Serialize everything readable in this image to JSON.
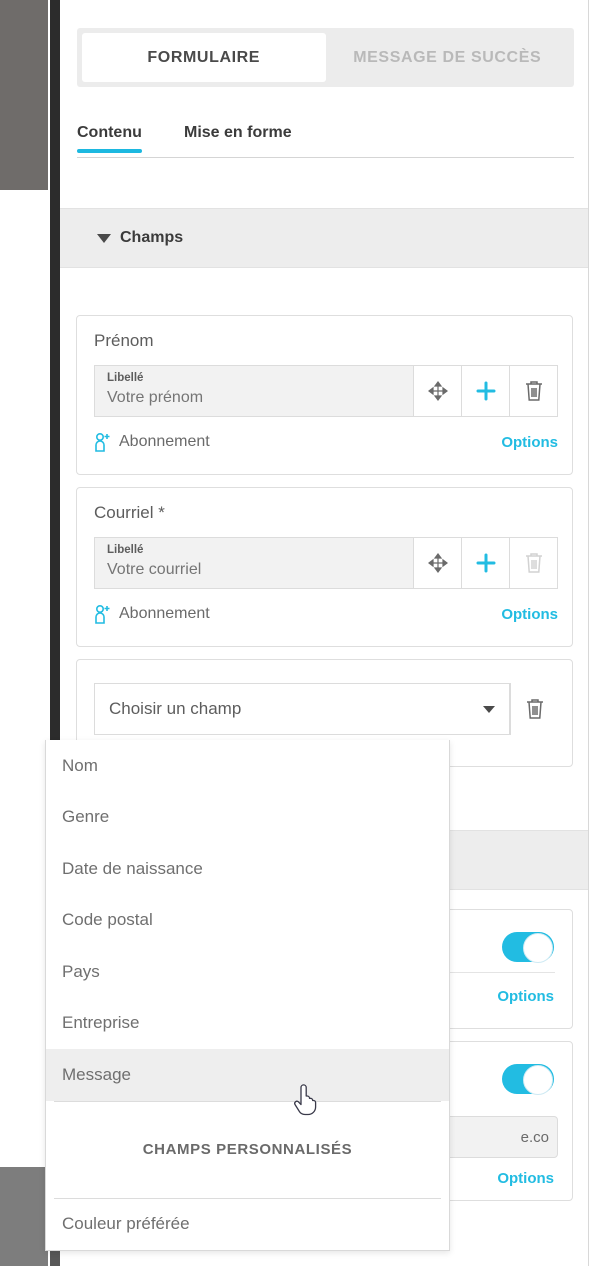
{
  "top_tabs": [
    {
      "label": "FORMULAIRE",
      "active": true
    },
    {
      "label": "MESSAGE DE SUCCÈS",
      "active": false
    }
  ],
  "sub_tabs": [
    {
      "label": "Contenu",
      "active": true
    },
    {
      "label": "Mise en forme",
      "active": false
    }
  ],
  "sections": [
    {
      "title": "Champs",
      "caret": "caret-down-icon"
    },
    {
      "title": "",
      "caret": "caret-down-icon"
    }
  ],
  "fields": [
    {
      "title": "Prénom",
      "label": "Libellé",
      "value": "Votre prénom",
      "subscription_text": "Abonnement",
      "subscription_icon": "person-add-icon",
      "options_label": "Options",
      "actions": [
        {
          "name": "move-icon",
          "enabled": true
        },
        {
          "name": "plus-icon",
          "enabled": true
        },
        {
          "name": "trash-icon",
          "enabled": true
        }
      ]
    },
    {
      "title": "Courriel *",
      "label": "Libellé",
      "value": "Votre courriel",
      "subscription_text": "Abonnement",
      "subscription_icon": "person-add-icon",
      "options_label": "Options",
      "actions": [
        {
          "name": "move-icon",
          "enabled": true
        },
        {
          "name": "plus-icon",
          "enabled": true
        },
        {
          "name": "trash-icon",
          "enabled": false
        }
      ]
    }
  ],
  "field_selector": {
    "placeholder": "Choisir un champ",
    "caret_icon": "chevron-down-icon",
    "delete_icon": "trash-icon"
  },
  "dropdown": {
    "options": [
      {
        "label": "Nom",
        "highlighted": false
      },
      {
        "label": "Genre",
        "highlighted": false
      },
      {
        "label": "Date de naissance",
        "highlighted": false
      },
      {
        "label": "Code postal",
        "highlighted": false
      },
      {
        "label": "Pays",
        "highlighted": false
      },
      {
        "label": "Entreprise",
        "highlighted": false
      },
      {
        "label": "Message",
        "highlighted": true
      }
    ],
    "group_header": "CHAMPS PERSONNALISÉS",
    "custom_options": [
      {
        "label": "Couleur préférée",
        "highlighted": false
      }
    ]
  },
  "hidden_cards": [
    {
      "options_label": "Options",
      "toggle_on": true,
      "value": ""
    },
    {
      "options_label": "Options",
      "toggle_on": true,
      "value": "e.co"
    }
  ],
  "colors": {
    "accent": "#22bce2",
    "tab_underline": "#1cb8e0",
    "band": "#ededed",
    "text": "#5d5d5d",
    "muted": "#b9b9b9"
  },
  "cursor": {
    "type": "pointer-hand-cursor"
  }
}
